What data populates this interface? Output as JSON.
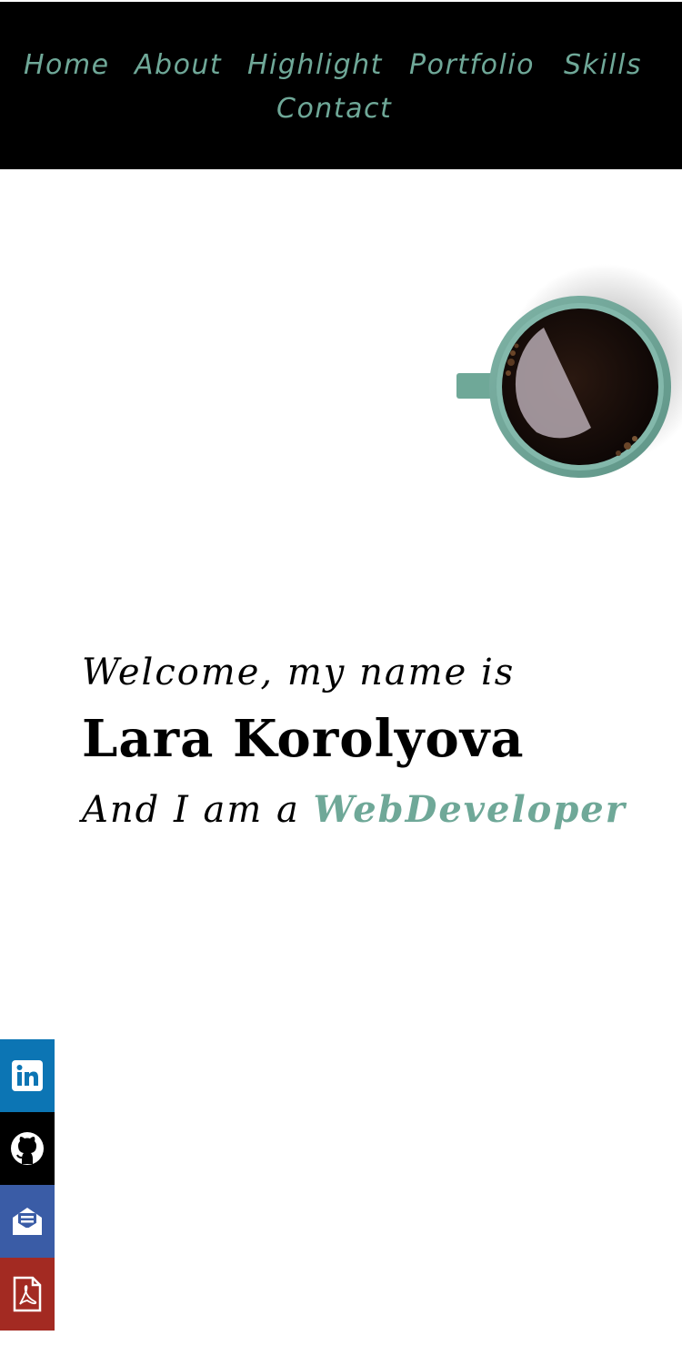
{
  "nav": {
    "items": [
      {
        "label": "Home"
      },
      {
        "label": "About"
      },
      {
        "label": "Highlight"
      },
      {
        "label": "Portfolio"
      },
      {
        "label": "Skills"
      },
      {
        "label": "Contact"
      }
    ]
  },
  "hero": {
    "welcome": "Welcome, my name is",
    "name": "Lara Korolyova",
    "role_prefix": "And I am a",
    "role_accent": "WebDeveloper"
  },
  "social": {
    "items": [
      {
        "name": "linkedin",
        "icon": "linkedin-icon",
        "color": "#0c75b4"
      },
      {
        "name": "github",
        "icon": "github-icon",
        "color": "#000000"
      },
      {
        "name": "email",
        "icon": "email-icon",
        "color": "#3a5ca6"
      },
      {
        "name": "resume-pdf",
        "icon": "pdf-icon",
        "color": "#a32a22"
      }
    ]
  },
  "colors": {
    "accent": "#6fa898",
    "nav_bg": "#000000",
    "background": "#ffffff"
  }
}
